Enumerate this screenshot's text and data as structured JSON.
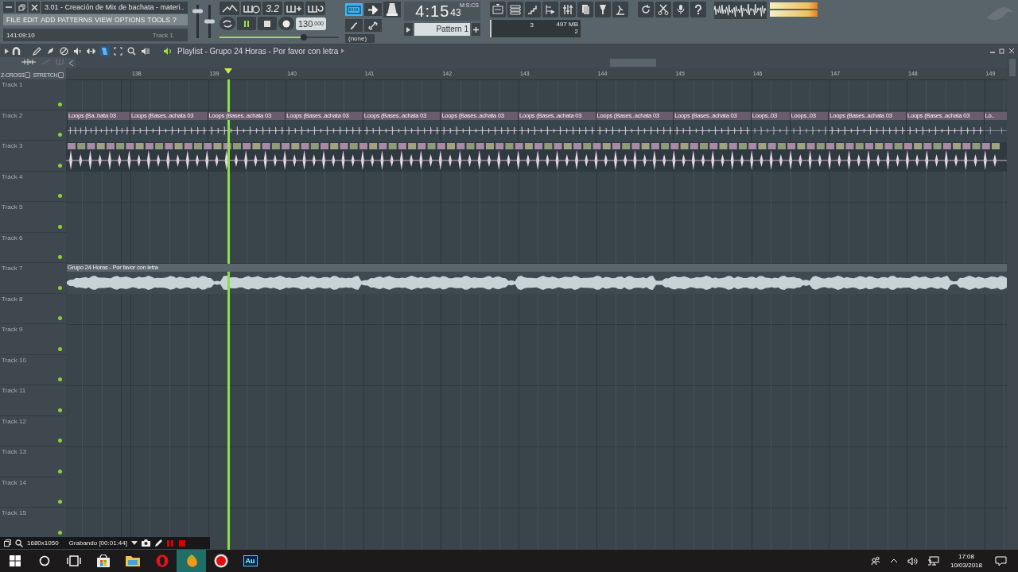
{
  "window": {
    "title": "3.01 - Creación de Mix de bachata - materi.."
  },
  "menu": [
    "FILE",
    "EDIT",
    "ADD",
    "PATTERNS",
    "VIEW",
    "OPTIONS",
    "TOOLS",
    "?"
  ],
  "hint_bar": {
    "position": "141:09:10",
    "target": "Track 1"
  },
  "master_volume": {
    "level": 0.8
  },
  "master_pitch": {
    "level": 0.5
  },
  "transport": {
    "playing": true,
    "recording": false,
    "snap": "3.2",
    "tempo_main": "130",
    "tempo_fraction": ".000"
  },
  "master_tempo": {
    "level": 0.73
  },
  "typing_keyboard": {
    "on": true
  },
  "channel_select": "(none)",
  "time": {
    "value": "4:15",
    "centis": "43",
    "unit": "M:S:CS"
  },
  "pattern": {
    "name": "Pattern 1"
  },
  "cpu": {
    "polyphony": "3",
    "memory": "497 MB",
    "voices": "2"
  },
  "playlist": {
    "title": "Playlist - Grupo 24 Horas - Por favor con letra",
    "tools": [
      {
        "kind": "pencil",
        "selected": false
      },
      {
        "kind": "paint",
        "selected": false
      },
      {
        "kind": "delete",
        "selected": false
      },
      {
        "kind": "mute",
        "selected": false
      },
      {
        "kind": "slip",
        "selected": false
      },
      {
        "kind": "slice",
        "selected": true
      },
      {
        "kind": "select",
        "selected": false
      },
      {
        "kind": "zoom",
        "selected": false
      },
      {
        "kind": "playback",
        "selected": false
      }
    ],
    "zcross": {
      "label": "Z-CROSS",
      "checked": false
    },
    "stretch": {
      "label": "STRETCH",
      "checked": false
    },
    "ruler": [
      "138",
      "139",
      "140",
      "141",
      "142",
      "143",
      "144",
      "145",
      "146",
      "147",
      "148",
      "149"
    ],
    "tracks": [
      {
        "name": "Track 1",
        "kind": "empty"
      },
      {
        "name": "Track 2",
        "kind": "loops",
        "clips": [
          {
            "label": "Loops (Ba..hata 03",
            "kind": "start"
          },
          {
            "label": "Loops (Bases..achata 03",
            "kind": "full"
          },
          {
            "label": "Loops (Bases..achata 03",
            "kind": "full"
          },
          {
            "label": "Loops (Bases..achata 03",
            "kind": "full"
          },
          {
            "label": "Loops (Bases..achata 03",
            "kind": "full"
          },
          {
            "label": "Loops (Bases..achata 03",
            "kind": "full"
          },
          {
            "label": "Loops (Bases..achata 03",
            "kind": "full"
          },
          {
            "label": "Loops (Bases..achata 03",
            "kind": "full"
          },
          {
            "label": "Loops (Bases..achata 03",
            "kind": "full"
          },
          {
            "label": "Loops..03",
            "kind": "half"
          },
          {
            "label": "Loops..03",
            "kind": "half"
          },
          {
            "label": "Loops (Bases..achata 03",
            "kind": "full"
          },
          {
            "label": "Loops (Bases..achata 03",
            "kind": "full"
          },
          {
            "label": "Lo..",
            "kind": "end"
          }
        ]
      },
      {
        "name": "Track 3",
        "kind": "beats"
      },
      {
        "name": "Track 4",
        "kind": "empty"
      },
      {
        "name": "Track 5",
        "kind": "empty"
      },
      {
        "name": "Track 6",
        "kind": "empty"
      },
      {
        "name": "Track 7",
        "kind": "audio",
        "clips": [
          {
            "label": "Grupo 24 Horas - Por favor con letra",
            "kind": "audio"
          }
        ]
      },
      {
        "name": "Track 8",
        "kind": "empty"
      },
      {
        "name": "Track 9",
        "kind": "empty"
      },
      {
        "name": "Track 10",
        "kind": "empty"
      },
      {
        "name": "Track 11",
        "kind": "empty"
      },
      {
        "name": "Track 12",
        "kind": "empty"
      },
      {
        "name": "Track 13",
        "kind": "empty"
      },
      {
        "name": "Track 14",
        "kind": "empty"
      },
      {
        "name": "Track 15",
        "kind": "empty"
      }
    ]
  },
  "recorder": {
    "resolution": "1680x1050",
    "status": "Grabando [00:01:44]"
  },
  "taskbar": {
    "apps": [
      {
        "kind": "store",
        "selected": false
      },
      {
        "kind": "folder",
        "selected": false
      },
      {
        "kind": "opera",
        "selected": false
      },
      {
        "kind": "fl",
        "selected": true
      },
      {
        "kind": "record",
        "selected": false
      },
      {
        "kind": "audition",
        "label": "Au",
        "selected": false
      }
    ],
    "time": "17:08",
    "date": "10/03/2018"
  }
}
